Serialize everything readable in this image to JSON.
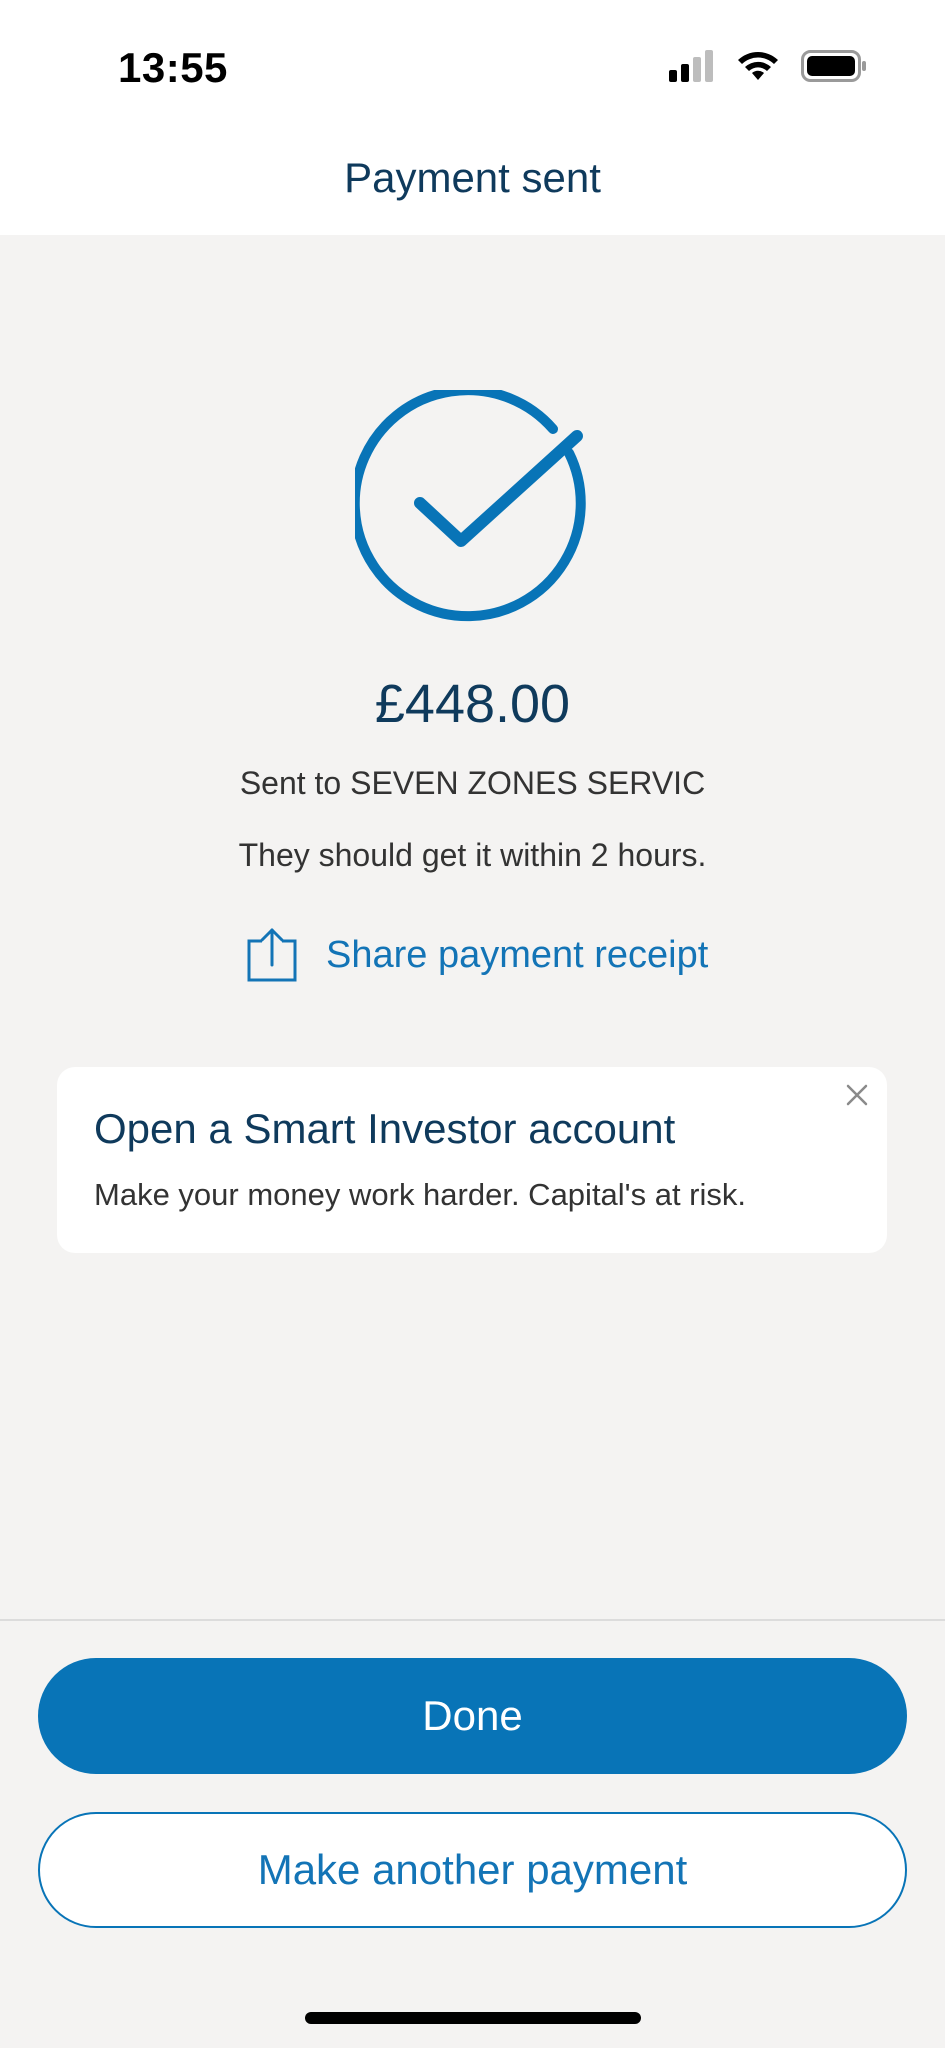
{
  "status_bar": {
    "time": "13:55",
    "icons": [
      "cellular-signal-icon",
      "wifi-icon",
      "battery-icon"
    ]
  },
  "header": {
    "title": "Payment sent"
  },
  "confirmation": {
    "icon": "checkmark-circle-icon",
    "amount": "£448.00",
    "sent_to": "Sent to SEVEN ZONES SERVIC",
    "eta": "They should get it within 2 hours.",
    "share_label": "Share payment receipt",
    "share_icon": "share-icon"
  },
  "promo": {
    "title": "Open a Smart Investor account",
    "text": "Make your money work harder. Capital's at risk.",
    "close_icon": "close-icon"
  },
  "actions": {
    "done_label": "Done",
    "another_label": "Make another payment"
  },
  "colors": {
    "accent": "#0874b7",
    "title_text": "#0f3a5c",
    "background": "#f4f3f2"
  }
}
